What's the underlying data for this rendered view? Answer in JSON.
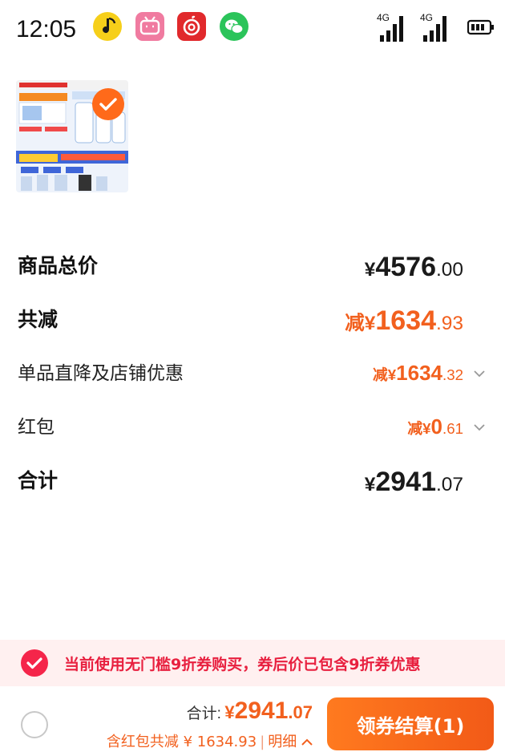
{
  "status_bar": {
    "time": "12:05",
    "apps": [
      "music-app-icon",
      "bilibili-app-icon",
      "netease-music-app-icon",
      "wechat-app-icon"
    ],
    "signal_1_label": "4G",
    "signal_2_label": "4G",
    "battery": "battery-icon"
  },
  "product": {
    "thumbnail": "product-thumbnail-image",
    "selected": true
  },
  "summary": {
    "subtotal": {
      "label": "商品总价",
      "currency": "¥",
      "integer": "4576",
      "decimal": ".00"
    },
    "total_discount": {
      "label": "共减",
      "prefix": "减",
      "currency": "¥",
      "integer": "1634",
      "decimal": ".93"
    },
    "store_discount": {
      "label": "单品直降及店铺优惠",
      "prefix": "减",
      "currency": "¥",
      "integer": "1634",
      "decimal": ".32"
    },
    "red_packet": {
      "label": "红包",
      "prefix": "减",
      "currency": "¥",
      "integer": "0",
      "decimal": ".61"
    },
    "total": {
      "label": "合计",
      "currency": "¥",
      "integer": "2941",
      "decimal": ".07"
    }
  },
  "notice": {
    "text": "当前使用无门槛9折券购买，券后价已包含9折券优惠",
    "checked": true
  },
  "bottom_bar": {
    "total_label": "合计:",
    "total_currency": "¥",
    "total_integer": "2941",
    "total_decimal": ".07",
    "discount_text": "含红包共减 ¥ 1634.93",
    "separator": "|",
    "detail_label": "明细",
    "checkout_label": "领券结算(1)"
  },
  "colors": {
    "accent_orange": "#f2601e",
    "notice_red": "#e8203f",
    "notice_bg": "#fff0f0"
  }
}
